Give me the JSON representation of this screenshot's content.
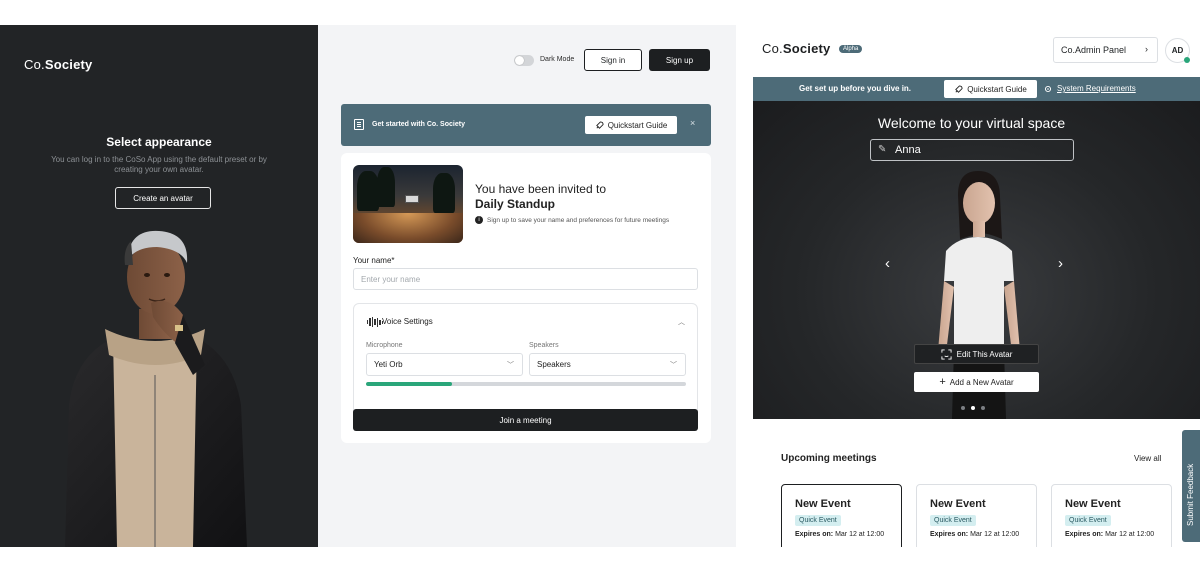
{
  "left": {
    "logo_co": "Co.",
    "logo_society": "Society",
    "title": "Select appearance",
    "subtitle": "You can log in to the CoSo App using the default preset or by creating your own avatar.",
    "create_avatar_label": "Create an avatar"
  },
  "middle": {
    "dark_mode_label": "Dark Mode",
    "sign_in_label": "Sign in",
    "sign_up_label": "Sign up",
    "banner_text": "Get started with Co. Society",
    "quickstart_label": "Quickstart Guide",
    "close_glyph": "×",
    "invite_line1": "You have been invited to",
    "meeting_name": "Daily Standup",
    "info_text": "Sign up to save your name and preferences for future meetings",
    "name_label": "Your name*",
    "name_placeholder": "Enter your name",
    "voice_title": "Voice Settings",
    "microphone_label": "Microphone",
    "microphone_value": "Yeti Orb",
    "speakers_label": "Speakers",
    "speakers_value": "Speakers",
    "mic_level_fraction": 0.27,
    "join_label": "Join a meeting"
  },
  "right": {
    "logo_co": "Co.",
    "logo_society": "Society",
    "alpha_badge": "Alpha",
    "admin_panel_label": "Co.Admin Panel",
    "user_initials": "AD",
    "banner_text": "Get set up before you dive in.",
    "quickstart_label": "Quickstart Guide",
    "system_requirements_label": "System Requirements",
    "welcome_title": "Welcome to your virtual space",
    "avatar_name": "Anna",
    "edit_avatar_label": "Edit This Avatar",
    "add_avatar_label": "Add a New Avatar",
    "carousel_active_index": 1,
    "carousel_count": 3,
    "upcoming_title": "Upcoming meetings",
    "view_all_label": "View all",
    "meetings": [
      {
        "title": "New Event",
        "badge": "Quick Event",
        "expires_label": "Expires on:",
        "expires_value": "Mar 12 at 12:00"
      },
      {
        "title": "New Event",
        "badge": "Quick Event",
        "expires_label": "Expires on:",
        "expires_value": "Mar 12 at 12:00"
      },
      {
        "title": "New Event",
        "badge": "Quick Event",
        "expires_label": "Expires on:",
        "expires_value": "Mar 12 at 12:00"
      }
    ],
    "feedback_label": "Submit Feedback"
  },
  "icons": {
    "doc": "document-icon",
    "rocket": "rocket-icon",
    "gear": "gear-icon",
    "pencil": "pencil-icon",
    "face_scan": "face-scan-icon",
    "plus": "plus-icon",
    "info": "info-icon",
    "sound_wave": "sound-wave-icon"
  },
  "colors": {
    "teal": "#4d6b78",
    "dark": "#1d1f21",
    "green": "#2aa67a"
  }
}
